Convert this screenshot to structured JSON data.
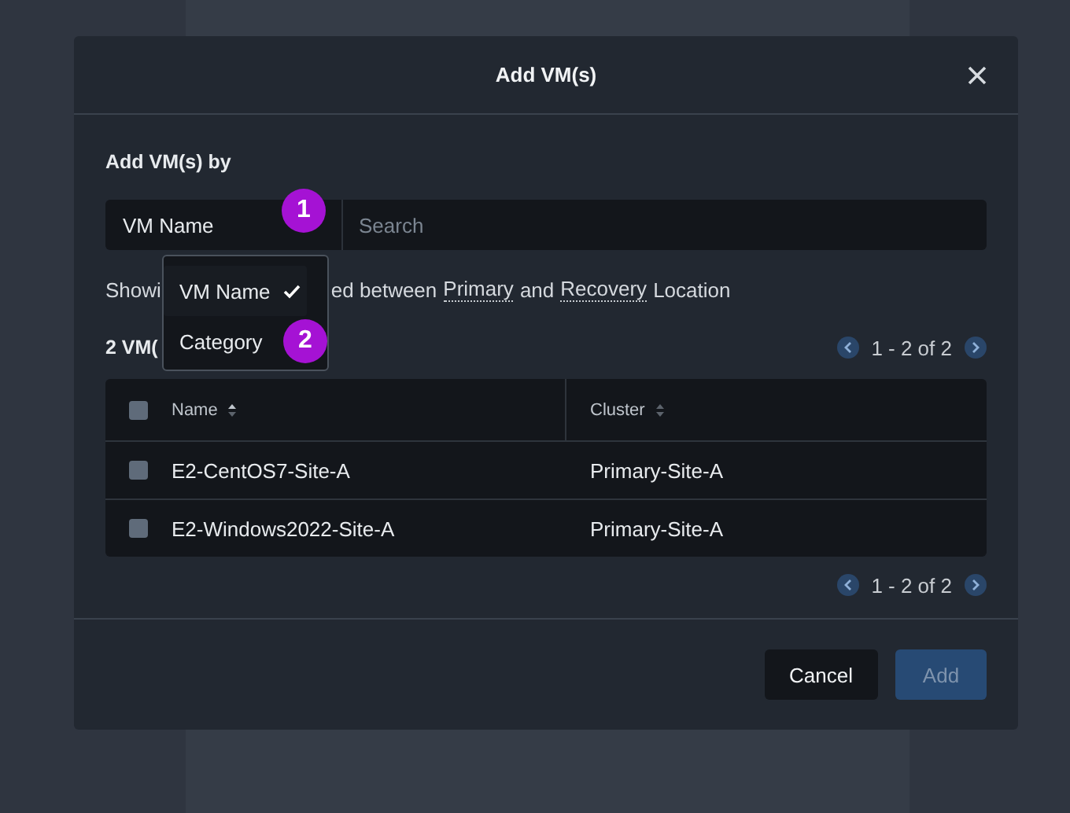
{
  "dialog": {
    "title": "Add VM(s)"
  },
  "add_by": {
    "label": "Add VM(s) by",
    "selector_value": "VM Name",
    "search": {
      "placeholder": "Search"
    }
  },
  "dropdown": {
    "options": [
      {
        "label": "VM Name",
        "selected": true
      },
      {
        "label": "Category",
        "selected": false
      }
    ]
  },
  "annotations": [
    {
      "label": "1"
    },
    {
      "label": "2"
    }
  ],
  "info": {
    "visible_start": "Showi",
    "visible_rest": "ed between",
    "link_1": "Primary",
    "middle": "and",
    "link_2": "Recovery",
    "end": "Location"
  },
  "count": "2 VM(",
  "pagination_top": "1 - 2 of 2",
  "table": {
    "columns": [
      {
        "label": "Name"
      },
      {
        "label": "Cluster"
      }
    ],
    "header_checked": false,
    "rows": [
      {
        "name": "E2-CentOS7-Site-A",
        "cluster": "Primary-Site-A",
        "checked": false
      },
      {
        "name": "E2-Windows2022-Site-A",
        "cluster": "Primary-Site-A",
        "checked": false
      }
    ]
  },
  "pagination_bottom": "1 - 2 of 2",
  "buttons": [
    {
      "label": "Cancel",
      "kind": "secondary",
      "disabled": false
    },
    {
      "label": "Add",
      "kind": "primary",
      "disabled": true
    }
  ]
}
